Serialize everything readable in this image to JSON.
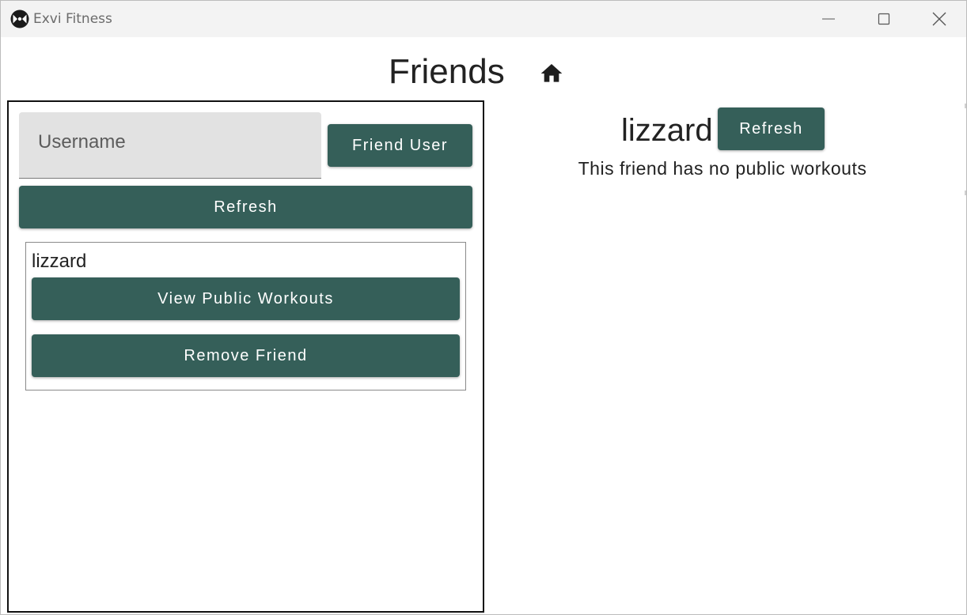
{
  "window": {
    "title": "Exvi Fitness",
    "icon": "exvi-logo-icon"
  },
  "header": {
    "title": "Friends",
    "home_icon": "home-icon"
  },
  "friends_panel": {
    "username_placeholder": "Username",
    "username_value": "",
    "friend_user_label": "Friend User",
    "refresh_label": "Refresh",
    "friends": [
      {
        "name": "lizzard",
        "view_label": "View Public Workouts",
        "remove_label": "Remove Friend"
      }
    ]
  },
  "detail_panel": {
    "name": "lizzard",
    "refresh_label": "Refresh",
    "message": "This friend has no public workouts"
  },
  "colors": {
    "button": "#355f59",
    "button_text": "#ffffff",
    "input_bg": "#e2e2e2",
    "titlebar": "#f3f3f3"
  }
}
